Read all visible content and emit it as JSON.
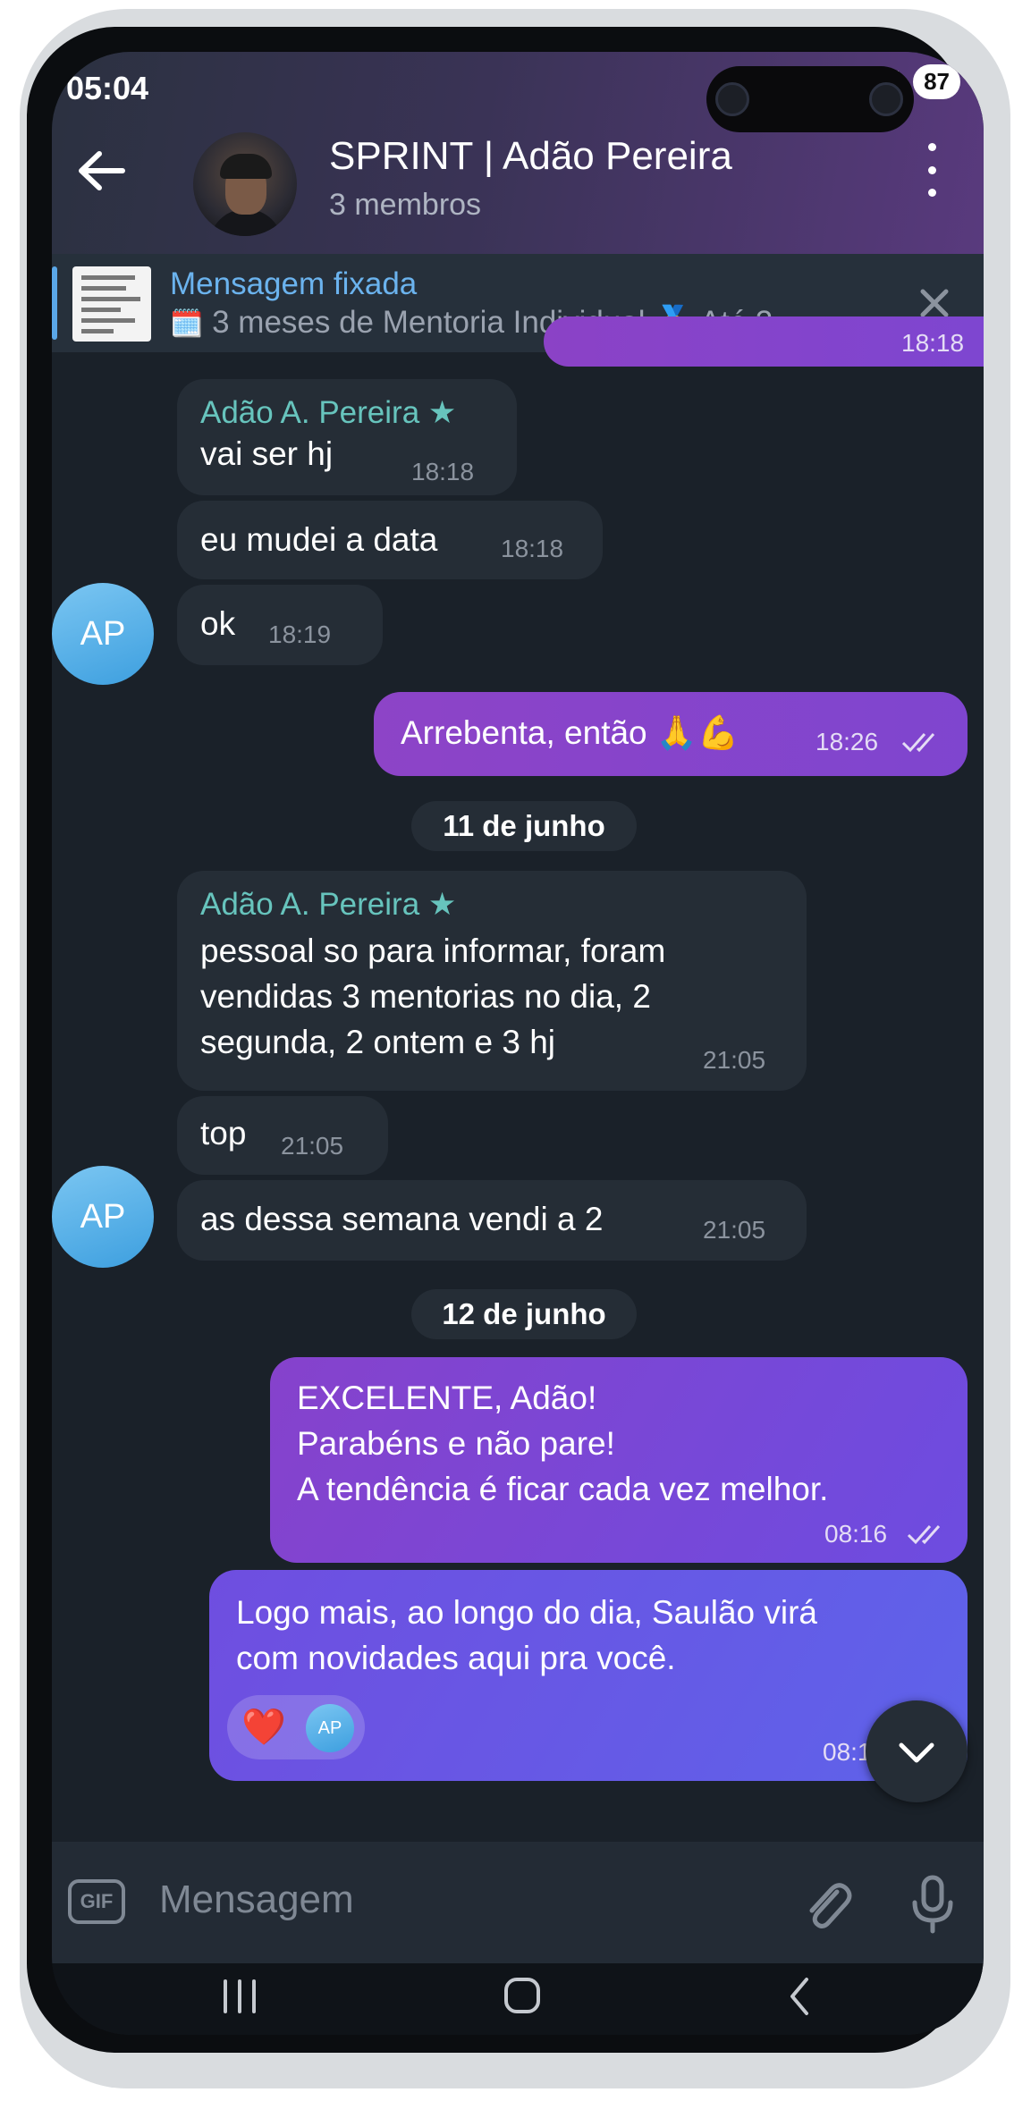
{
  "status": {
    "time": "05:04",
    "battery": "87"
  },
  "header": {
    "title": "SPRINT | Adão Pereira",
    "subtitle": "3 membros"
  },
  "pinned": {
    "label": "Mensagem fixada",
    "text": "3 meses de Mentoria Individual 🥇 Até 3..."
  },
  "messages": {
    "top_partial_time": "18:18",
    "m1_sender": "Adão A. Pereira",
    "m1_text": "vai ser hj",
    "m1_time": "18:18",
    "m2_text": "eu mudei a data",
    "m2_time": "18:18",
    "m3_text": "ok",
    "m3_time": "18:19",
    "avatar1": "AP",
    "m4_text": "Arrebenta, então 🙏💪",
    "m4_time": "18:26",
    "date1": "11 de junho",
    "m5_sender": "Adão A. Pereira",
    "m5_line1": "pessoal so para informar, foram",
    "m5_line2": "vendidas 3 mentorias no dia, 2",
    "m5_line3": "segunda, 2 ontem e 3 hj",
    "m5_time": "21:05",
    "m6_text": "top",
    "m6_time": "21:05",
    "m7_text": "as dessa semana vendi a 2",
    "m7_time": "21:05",
    "avatar2": "AP",
    "date2": "12 de junho",
    "m8_line1": "EXCELENTE, Adão!",
    "m8_line2": "Parabéns e não pare!",
    "m8_line3": "A tendência é ficar cada vez melhor.",
    "m8_time": "08:16",
    "m9_line1": "Logo mais, ao longo do dia, Saulão virá",
    "m9_line2": "com novidades aqui pra você.",
    "m9_reaction": "❤️",
    "m9_reactor": "AP",
    "m9_time": "08:1"
  },
  "composer": {
    "placeholder": "Mensagem",
    "gif": "GIF"
  },
  "colors": {
    "accent": "#6bb3ee",
    "sender": "#67c4bd",
    "outgoing_start": "#8e44c9",
    "outgoing_end": "#5f63e8"
  }
}
